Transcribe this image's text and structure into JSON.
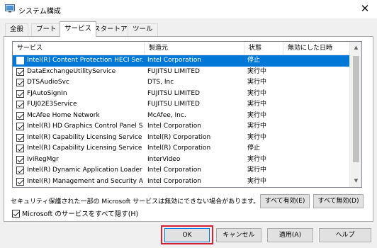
{
  "window": {
    "title": "システム構成",
    "close_glyph": "✕"
  },
  "tabs": [
    {
      "label": "全般"
    },
    {
      "label": "ブート"
    },
    {
      "label": "サービス"
    },
    {
      "label": "スタートアップ"
    },
    {
      "label": "ツール"
    }
  ],
  "columns": [
    "サービス",
    "製造元",
    "状態",
    "無効にした日時"
  ],
  "services": [
    {
      "name": "Intel(R) Content Protection HECI Ser...",
      "manufacturer": "Intel Corporation",
      "status": "停止",
      "disabled_at": "",
      "checked": false,
      "selected": true
    },
    {
      "name": "DataExchangeUtilityService",
      "manufacturer": "FUJITSU LIMITED",
      "status": "実行中",
      "disabled_at": "",
      "checked": true,
      "selected": false
    },
    {
      "name": "DTSAudioSvc",
      "manufacturer": "DTS, Inc",
      "status": "実行中",
      "disabled_at": "",
      "checked": true,
      "selected": false
    },
    {
      "name": "FJAutoSignIn",
      "manufacturer": "FUJITSU LIMITED",
      "status": "実行中",
      "disabled_at": "",
      "checked": true,
      "selected": false
    },
    {
      "name": "FUJ02E3Service",
      "manufacturer": "FUJITSU LIMITED",
      "status": "実行中",
      "disabled_at": "",
      "checked": true,
      "selected": false
    },
    {
      "name": "McAfee Home Network",
      "manufacturer": "McAfee, Inc.",
      "status": "実行中",
      "disabled_at": "",
      "checked": true,
      "selected": false
    },
    {
      "name": "Intel(R) HD Graphics Control Panel S...",
      "manufacturer": "Intel Corporation",
      "status": "実行中",
      "disabled_at": "",
      "checked": true,
      "selected": false
    },
    {
      "name": "Intel(R) Capability Licensing Service I...",
      "manufacturer": "Intel(R) Corporation",
      "status": "実行中",
      "disabled_at": "",
      "checked": true,
      "selected": false
    },
    {
      "name": "Intel(R) Capability Licensing Service ...",
      "manufacturer": "Intel(R) Corporation",
      "status": "停止",
      "disabled_at": "",
      "checked": true,
      "selected": false
    },
    {
      "name": "IviRegMgr",
      "manufacturer": "InterVideo",
      "status": "実行中",
      "disabled_at": "",
      "checked": true,
      "selected": false
    },
    {
      "name": "Intel(R) Dynamic Application Loader ...",
      "manufacturer": "Intel Corporation",
      "status": "実行中",
      "disabled_at": "",
      "checked": true,
      "selected": false
    },
    {
      "name": "Intel(R) Management and Security A...",
      "manufacturer": "Intel Corporation",
      "status": "実行中",
      "disabled_at": "",
      "checked": true,
      "selected": false
    }
  ],
  "note": "セキュリティ保護された一部の Microsoft サービスは無効にできない場合があります。",
  "enable_all_label": "すべて有効(E)",
  "disable_all_label": "すべて無効(D)",
  "hide_ms_label": "Microsoft のサービスをすべて隠す(H)",
  "hide_ms_checked": true,
  "buttons": {
    "ok": "OK",
    "cancel": "キャンセル",
    "apply": "適用(A)",
    "help": "ヘルプ"
  },
  "colors": {
    "selection": "#0078d7",
    "highlight_frame": "#d42030"
  },
  "icons": {
    "app": "system-config-icon",
    "close": "close-icon",
    "check": "checkbox-check-icon"
  }
}
